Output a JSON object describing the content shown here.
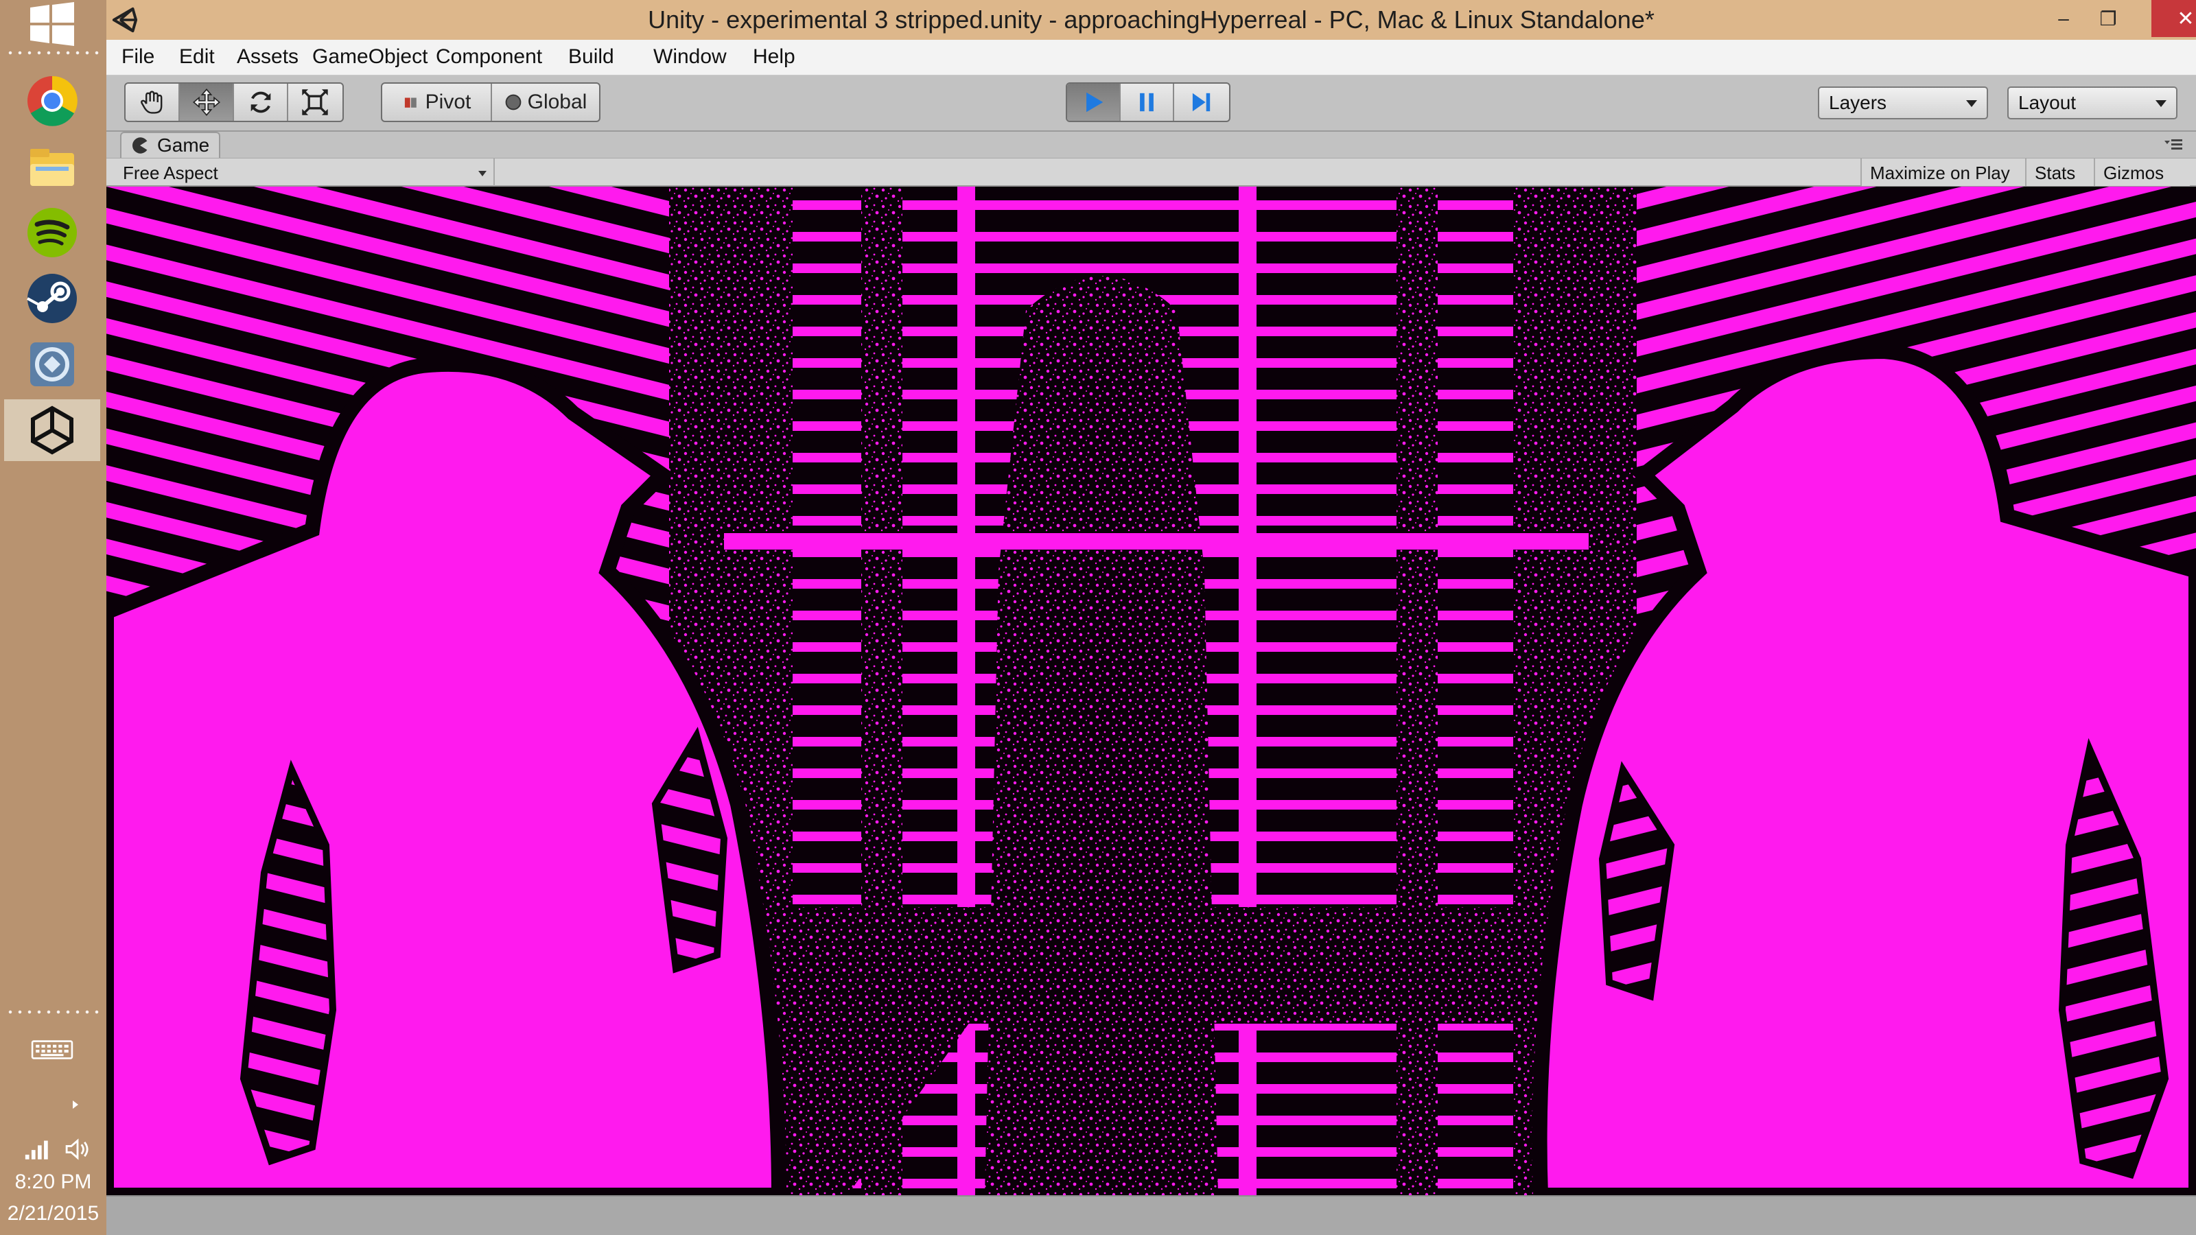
{
  "window": {
    "title": "Unity - experimental 3 stripped.unity - approachingHyperreal - PC, Mac & Linux Standalone*",
    "controls": {
      "minimize": "–",
      "restore": "❐",
      "close": "✕"
    }
  },
  "menu": {
    "items": [
      "File",
      "Edit",
      "Assets",
      "GameObject",
      "Component",
      "Build",
      "Window",
      "Help"
    ]
  },
  "toolbar": {
    "transform_tools": [
      "hand-icon",
      "move-icon",
      "rotate-icon",
      "scale-icon"
    ],
    "pivot_label": "Pivot",
    "global_label": "Global",
    "layers_label": "Layers",
    "layout_label": "Layout",
    "play_state": "playing"
  },
  "game_view": {
    "tab_label": "Game",
    "aspect": "Free Aspect",
    "maximize_on_play": "Maximize on Play",
    "stats": "Stats",
    "gizmos": "Gizmos",
    "scene_colors": {
      "magenta": "#ff1aee",
      "dark": "#0a0008"
    }
  },
  "taskbar": {
    "apps": [
      "start-windows-icon",
      "chrome-icon",
      "file-explorer-icon",
      "spotify-icon",
      "steam-icon",
      "remote-desktop-icon",
      "unity-icon"
    ],
    "time": "8:20 PM",
    "date": "2/21/2015"
  }
}
